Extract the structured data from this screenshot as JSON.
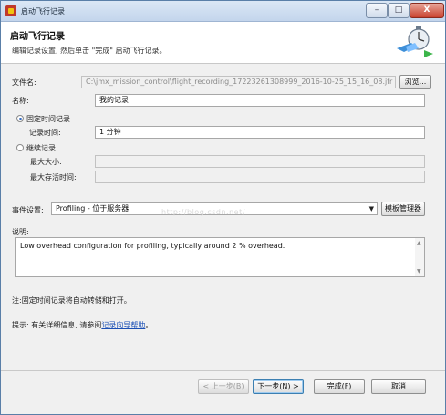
{
  "window": {
    "title": "启动飞行记录",
    "min_glyph": "–",
    "max_glyph": "□",
    "close_glyph": "X"
  },
  "header": {
    "title": "启动飞行记录",
    "subtitle": "编辑记录设置, 然后单击 \"完成\" 启动飞行记录。"
  },
  "form": {
    "file_label": "文件名:",
    "file_value": "C:\\jmx_mission_control\\flight_recording_17223261308999_2016-10-25_15_16_08.jfr",
    "browse_label": "浏览...",
    "name_label": "名称:",
    "name_value": "我的记录",
    "fixed_time_label": "固定时间记录",
    "record_time_label": "记录时间:",
    "record_time_value": "1 分钟",
    "continuous_label": "继续记录",
    "max_size_label": "最大大小:",
    "max_age_label": "最大存活时间:",
    "event_settings_label": "事件设置:",
    "event_settings_value": "Profiling - 位于服务器",
    "template_manager_label": "模板管理器",
    "description_label": "说明:",
    "description_value": "Low overhead configuration for profiling, typically around 2 % overhead."
  },
  "notes": {
    "note_prefix": "注:",
    "note_text": "固定时间记录将自动转储和打开。",
    "tip_prefix": "提示:",
    "tip_text": "有关详细信息, 请参阅",
    "tip_link": "记录向导帮助",
    "tip_end": "。"
  },
  "footer": {
    "back_label": "< 上一步(B)",
    "next_label": "下一步(N) >",
    "finish_label": "完成(F)",
    "cancel_label": "取消"
  },
  "watermark": "http://blog.csdn.net/"
}
